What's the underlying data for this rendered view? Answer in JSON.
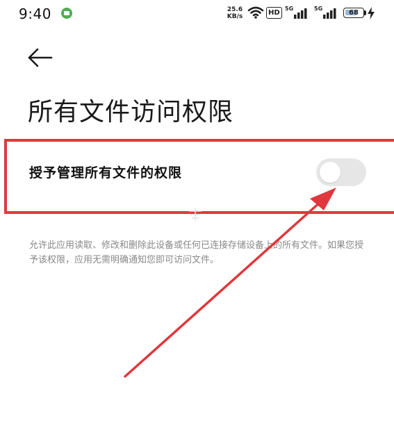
{
  "status_bar": {
    "time": "9:40",
    "net_speed_value": "25.6",
    "net_speed_unit": "KB/s",
    "hd_label": "HD",
    "signal_1_label": "5G",
    "signal_2_label": "5G",
    "battery_level": "68",
    "battery_fraction": 0.68,
    "app_icon": "android-app-icon",
    "wifi_icon": "wifi-icon",
    "charging_icon": "lightning-icon"
  },
  "header": {
    "back_icon": "arrow-left-icon",
    "title": "所有文件访问权限"
  },
  "setting": {
    "label": "授予管理所有文件的权限",
    "enabled": false
  },
  "description": "允许此应用读取、修改和删除此设备或任何已连接存储设备上的所有文件。如果您授予该权限，应用无需明确通知您即可访问文件。",
  "colors": {
    "annotation_red": "#e0383d",
    "toggle_off": "#e6e6e6",
    "description_text": "#888888"
  }
}
